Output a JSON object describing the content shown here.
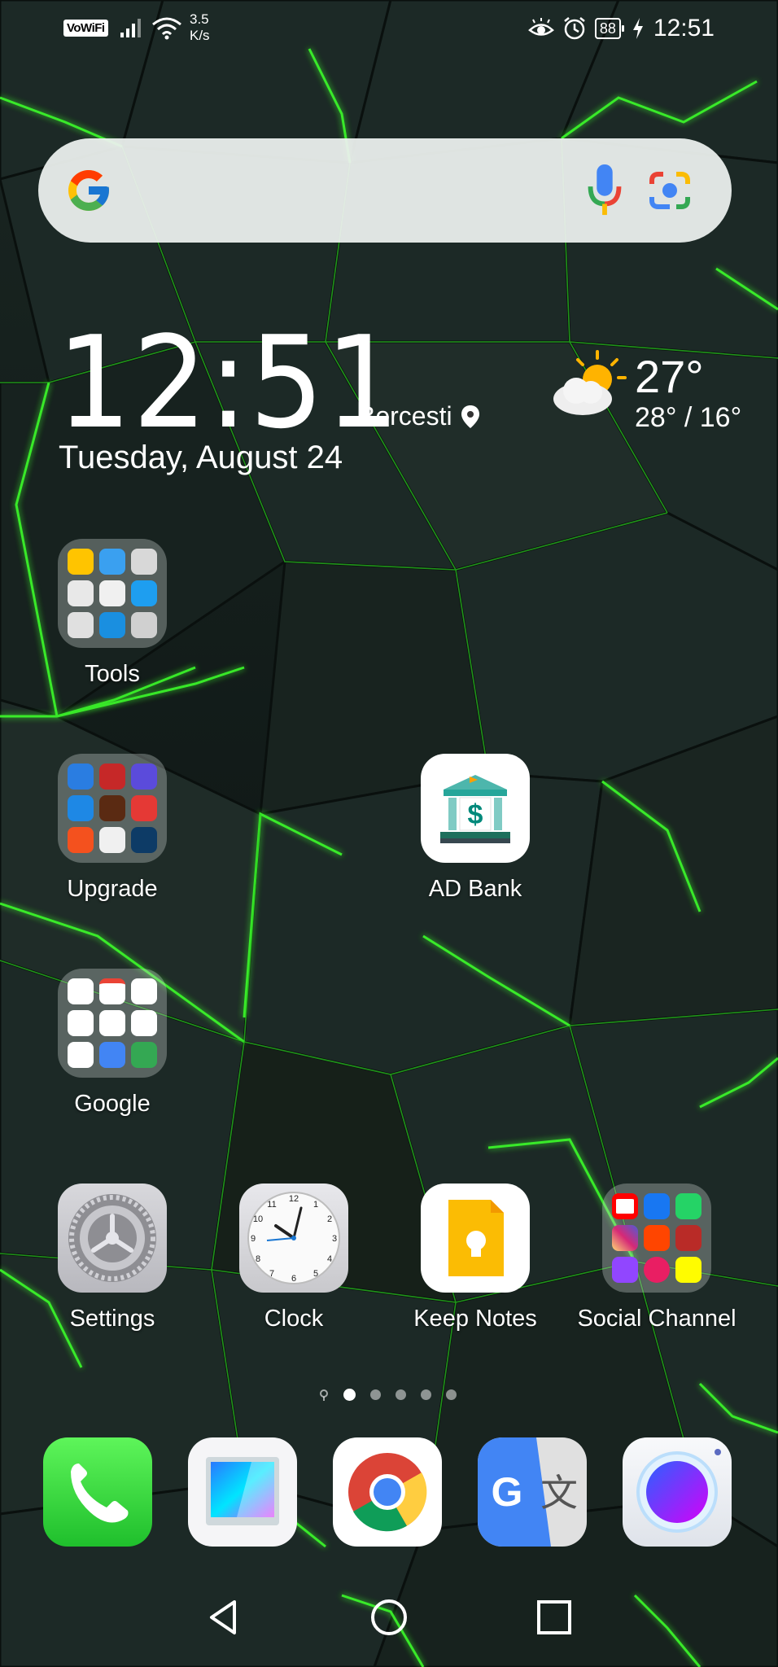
{
  "status_bar": {
    "vowifi": "VoWiFi",
    "speed_value": "3.5",
    "speed_unit": "K/s",
    "battery": "88",
    "time": "12:51",
    "icons": [
      "signal-icon",
      "wifi-icon",
      "eye-comfort-icon",
      "alarm-icon",
      "battery-icon",
      "charging-icon"
    ]
  },
  "search": {
    "icons": [
      "google-g-icon",
      "mic-icon",
      "lens-camera-icon"
    ]
  },
  "clock_widget": {
    "time": "12:51",
    "date": "Tuesday, August 24",
    "location": "Bercesti",
    "temperature": "27°",
    "range": "28° / 16°",
    "weather_icon": "partly-sunny-icon"
  },
  "apps": {
    "tools": "Tools",
    "upgrade": "Upgrade",
    "ad_bank": "AD Bank",
    "google": "Google",
    "settings": "Settings",
    "clock": "Clock",
    "keep_notes": "Keep Notes",
    "social_channel": "Social Channel"
  },
  "dock": [
    "phone-icon",
    "gallery-icon",
    "chrome-icon",
    "translate-icon",
    "browser-icon"
  ],
  "nav": [
    "back-icon",
    "home-icon",
    "recents-icon"
  ],
  "colors": {
    "wallpaper_dark": "#0d1412",
    "wallpaper_neon": "#3dff2a"
  }
}
